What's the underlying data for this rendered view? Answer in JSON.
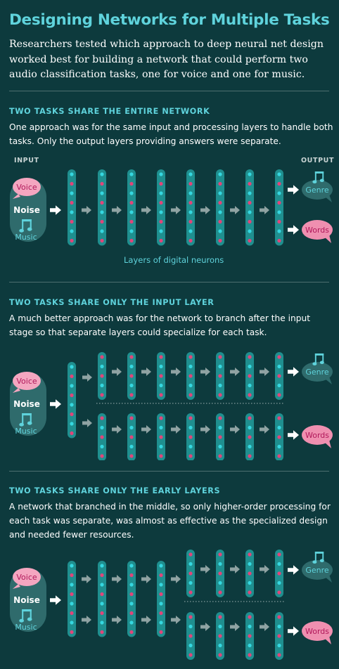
{
  "title": "Designing Networks for Multiple Tasks",
  "intro": "Researchers tested which approach to deep neural net design worked best for building a network that could perform two audio classification tasks, one for voice and one for music.",
  "labels": {
    "input": "INPUT",
    "output": "OUTPUT",
    "layers": "Layers of digital neurons"
  },
  "inputs": {
    "voice": "Voice",
    "noise": "Noise",
    "music": "Music"
  },
  "outputs": {
    "genre": "Genre",
    "words": "Words"
  },
  "sections": [
    {
      "title": "TWO TASKS SHARE THE ENTIRE NETWORK",
      "text": "One approach was for the same input and processing layers to handle both tasks. Only the output layers providing answers were separate."
    },
    {
      "title": "TWO TASKS SHARE ONLY THE INPUT LAYER",
      "text": "A much better approach was for the network to branch after the input stage so that separate layers could specialize for each task."
    },
    {
      "title": "TWO TASKS SHARE ONLY THE EARLY LAYERS",
      "text": "A network that branched in the middle, so only higher-order processing for each task was separate, was almost as effective as the specialized design and needed fewer resources."
    }
  ],
  "colors": {
    "background": "#0d3a3d",
    "accent": "#5fd3dc",
    "layer": "#1f8f8f",
    "neuron_cyan": "#35d7e0",
    "neuron_pink": "#e0467a",
    "voice_bubble": "#f4a6c0",
    "words_bubble": "#ef8fb0",
    "input_pill": "#2f6b6c",
    "genre_bubble": "#2f6b6c"
  },
  "icons": {
    "music": "music-note-icon",
    "arrow": "arrow-right-icon"
  }
}
